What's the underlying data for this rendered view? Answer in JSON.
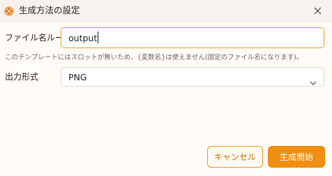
{
  "window": {
    "title": "生成方法の設定",
    "close_icon": "close-icon",
    "app_icon": "flower-icon"
  },
  "form": {
    "filename_rule": {
      "label": "ファイル名ルール",
      "value": "output"
    },
    "hint": "このテンプレートにはスロットが無いため、{変数名}は使えません(固定のファイル名になります)。",
    "output_format": {
      "label": "出力形式",
      "value": "PNG",
      "icon": "chevron-down-icon"
    }
  },
  "buttons": {
    "cancel": "キャンセル",
    "start": "生成開始"
  },
  "colors": {
    "accent": "#ef8e10",
    "accent_border": "#ee9b1b",
    "dialog_bg": "#fffbf7",
    "titlebar_bg": "#f6f2ee"
  }
}
